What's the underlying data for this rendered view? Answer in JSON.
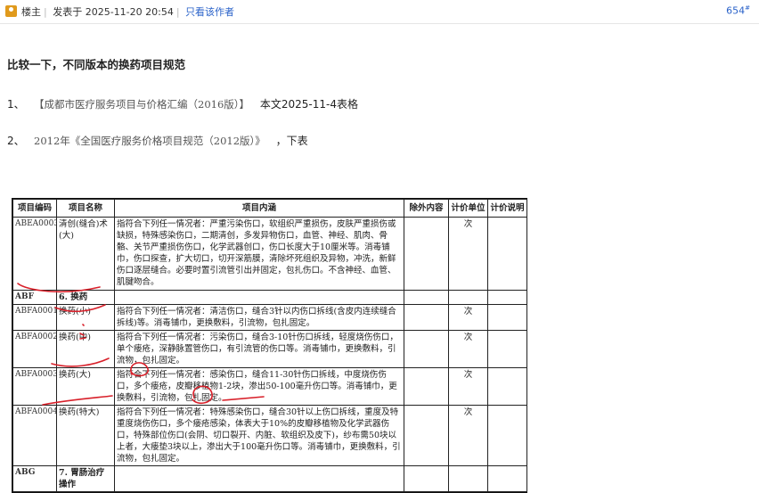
{
  "header": {
    "role": "楼主",
    "posted_label": "发表于",
    "datetime": "2025-11-20 20:54",
    "author_only_link": "只看该作者",
    "floor": "654",
    "floor_mark": "#"
  },
  "post": {
    "title": "比较一下，不同版本的换药项目规范",
    "items": [
      {
        "num": "1、",
        "source": "【成都市医疗服务项目与价格汇编（2016版）】",
        "note": "本文2025-11-4表格"
      },
      {
        "num": "2、",
        "source": "2012年《全国医疗服务价格项目规范（2012版）》",
        "note": "，下表"
      }
    ]
  },
  "table": {
    "headers": [
      "项目编码",
      "项目名称",
      "项目内涵",
      "除外内容",
      "计价单位",
      "计价说明"
    ],
    "rows": [
      {
        "code": "ABEA0003",
        "name": "清创(缝合)术(大)",
        "content": "指符合下列任一情况者：严重污染伤口，软组织严重损伤，皮肤严重损伤或缺损，特殊感染伤口，二期清创，多发异物伤口，血管、神经、肌肉、骨骼、关节严重损伤伤口，化学武器创口，伤口长度大于10厘米等。消毒铺巾，伤口探查，扩大切口，切开深筋膜，清除坏死组织及异物，冲洗，新鲜伤口逐层缝合。必要时置引流管引出并固定，包扎伤口。不含神经、血管、肌腱吻合。",
        "exclude": "",
        "unit": "次",
        "note": ""
      },
      {
        "code": "ABF",
        "name": "6. 换药",
        "content": "",
        "exclude": "",
        "unit": "",
        "note": "",
        "bold": true
      },
      {
        "code": "ABFA0001",
        "name": "换药(小)",
        "content": "指符合下列任一情况者：清洁伤口，缝合3针以内伤口拆线(含皮内连续缝合拆线)等。消毒铺巾，更换敷料，引流物，包扎固定。",
        "exclude": "",
        "unit": "次",
        "note": ""
      },
      {
        "code": "ABFA0002",
        "name": "换药(中)",
        "content": "指符合下列任一情况者：污染伤口，缝合3-10针伤口拆线，轻度烧伤伤口，单个瘘疮，深静脉置管伤口，有引流管的伤口等。消毒铺巾，更换敷料，引流物，包扎固定。",
        "exclude": "",
        "unit": "次",
        "note": ""
      },
      {
        "code": "ABFA0003",
        "name": "换药(大)",
        "content": "指符合下列任一情况者：感染伤口，缝合11-30针伤口拆线，中度烧伤伤口，多个瘘疮，皮瓣移植物1-2块，渗出50-100毫升伤口等。消毒铺巾，更换敷料，引流物，包扎固定。",
        "exclude": "",
        "unit": "次",
        "note": ""
      },
      {
        "code": "ABFA0004",
        "name": "换药(特大)",
        "content": "指符合下列任一情况者：特殊感染伤口，缝合30针以上伤口拆线，重度及特重度烧伤伤口，多个瘘疮感染，体表大于10%的皮瓣移植物及化学武器伤口，特殊部位伤口(会阴、切口裂开、内脏、软组织及皮下)，纱布需50块以上者，大瘘垫3块以上，渗出大于100毫升伤口等。消毒铺巾，更换敷料，引流物，包扎固定。",
        "exclude": "",
        "unit": "次",
        "note": ""
      },
      {
        "code": "ABG",
        "name": "7. 胃肠治疗操作",
        "content": "",
        "exclude": "",
        "unit": "",
        "note": "",
        "bold": true
      }
    ]
  },
  "colors": {
    "link": "#2a62c9",
    "avatar": "#e09a1c",
    "ink": "#d8202a"
  }
}
